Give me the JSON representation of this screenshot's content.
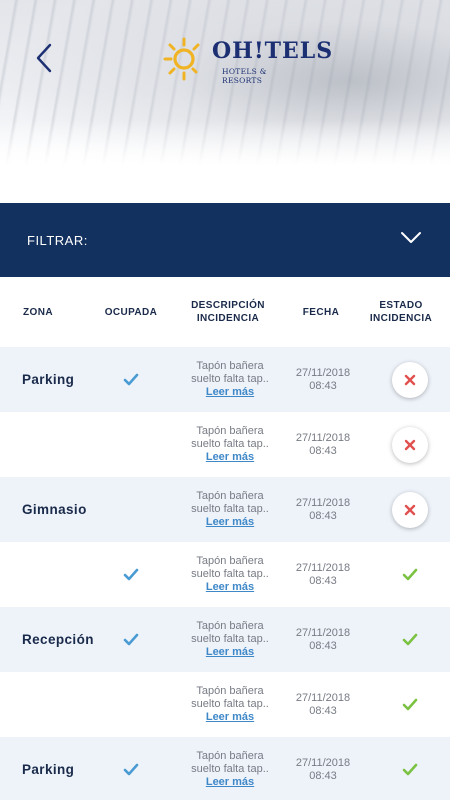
{
  "brand": {
    "name": "OH!TELS",
    "tagline": "HOTELS & RESORTS"
  },
  "filter": {
    "label": "FILTRAR:"
  },
  "columns": {
    "zona": "ZONA",
    "ocupada": "OCUPADA",
    "descripcion_l1": "DESCRIPCIÓN",
    "descripcion_l2": "INCIDENCIA",
    "fecha": "FECHA",
    "estado_l1": "ESTADO",
    "estado_l2": "INCIDENCIA"
  },
  "rows": [
    {
      "zona": "Parking",
      "ocupada": true,
      "desc_l1": "Tapón bañera",
      "desc_l2": "suelto falta tap..",
      "link": "Leer más",
      "date": "27/11/2018",
      "time": "08:43",
      "estado": "open"
    },
    {
      "zona": "",
      "ocupada": false,
      "desc_l1": "Tapón bañera",
      "desc_l2": "suelto falta tap..",
      "link": "Leer más",
      "date": "27/11/2018",
      "time": "08:43",
      "estado": "open"
    },
    {
      "zona": "Gimnasio",
      "ocupada": false,
      "desc_l1": "Tapón bañera",
      "desc_l2": "suelto falta tap..",
      "link": "Leer más",
      "date": "27/11/2018",
      "time": "08:43",
      "estado": "open"
    },
    {
      "zona": "",
      "ocupada": true,
      "desc_l1": "Tapón bañera",
      "desc_l2": "suelto falta tap..",
      "link": "Leer más",
      "date": "27/11/2018",
      "time": "08:43",
      "estado": "resolved"
    },
    {
      "zona": "Recepción",
      "ocupada": true,
      "desc_l1": "Tapón bañera",
      "desc_l2": "suelto falta tap..",
      "link": "Leer más",
      "date": "27/11/2018",
      "time": "08:43",
      "estado": "resolved"
    },
    {
      "zona": "",
      "ocupada": false,
      "desc_l1": "Tapón bañera",
      "desc_l2": "suelto falta tap..",
      "link": "Leer más",
      "date": "27/11/2018",
      "time": "08:43",
      "estado": "resolved"
    },
    {
      "zona": "Parking",
      "ocupada": true,
      "desc_l1": "Tapón bañera",
      "desc_l2": "suelto falta tap..",
      "link": "Leer más",
      "date": "27/11/2018",
      "time": "08:43",
      "estado": "resolved"
    }
  ],
  "icons": {
    "back": "chevron-left-icon",
    "filter": "chevron-down-icon",
    "ocupada": "checkmark-icon",
    "estado_open": "close-icon",
    "estado_resolved": "checkmark-icon",
    "logo": "sun-icon"
  },
  "colors": {
    "primary": "#13315f",
    "check_blue": "#4a9bd4",
    "check_green": "#7cc242",
    "x_red": "#e0514f",
    "link": "#3f88c8",
    "row_shade": "#eef3fa",
    "logo_sun": "#f0b323"
  }
}
